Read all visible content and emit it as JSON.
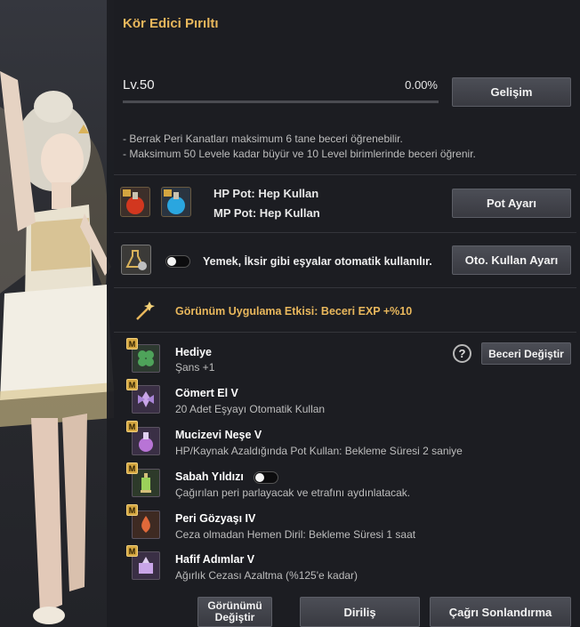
{
  "panel": {
    "title": "Kör Edici Pırıltı",
    "level_label": "Lv.50",
    "exp_percent_text": "0.00%",
    "exp_progress": 0,
    "growth_button": "Gelişim",
    "notes": [
      "- Berrak Peri Kanatları maksimum 6 tane beceri öğrenebilir.",
      "- Maksimum 50 Levele kadar büyür ve 10 Level birimlerinde beceri öğrenir."
    ]
  },
  "potions": {
    "hp_line": "HP Pot: Hep Kullan",
    "mp_line": "MP Pot: Hep Kullan",
    "button": "Pot Ayarı"
  },
  "auto_use": {
    "text": "Yemek, İksir gibi eşyalar otomatik kullanılır.",
    "toggle_on": false,
    "button": "Oto. Kullan Ayarı"
  },
  "appearance_effect": {
    "text": "Görünüm Uygulama Etkisi: Beceri EXP +%10"
  },
  "skill_change_button": "Beceri Değiştir",
  "help_symbol": "?",
  "skills": [
    {
      "badge": "M",
      "name": "Hediye",
      "desc": "Şans +1",
      "icon": "clover-icon"
    },
    {
      "badge": "M",
      "name": "Cömert El V",
      "desc": "20 Adet Eşyayı Otomatik Kullan",
      "icon": "fairy-icon"
    },
    {
      "badge": "M",
      "name": "Mucizevi Neşe V",
      "desc": "HP/Kaynak Azaldığında Pot Kullan: Bekleme Süresi 2 saniye",
      "icon": "potion-icon"
    },
    {
      "badge": "M",
      "name": "Sabah Yıldızı",
      "desc": "Çağırılan peri parlayacak ve etrafını aydınlatacak.",
      "icon": "lantern-icon",
      "toggle_on": false
    },
    {
      "badge": "M",
      "name": "Peri Gözyaşı IV",
      "desc": "Ceza olmadan Hemen Diril: Bekleme Süresi 1 saat",
      "icon": "tear-icon"
    },
    {
      "badge": "M",
      "name": "Hafif Adımlar V",
      "desc": "Ağırlık Cezası Azaltma (%125'e kadar)",
      "icon": "weight-icon"
    }
  ],
  "footer": {
    "appearance_button": "Görünümü Değiştir",
    "revive_button": "Diriliş",
    "end_summon_button": "Çağrı Sonlandırma"
  },
  "colors": {
    "accent_gold": "#e8b75c",
    "panel_bg": "#1c1d22"
  }
}
